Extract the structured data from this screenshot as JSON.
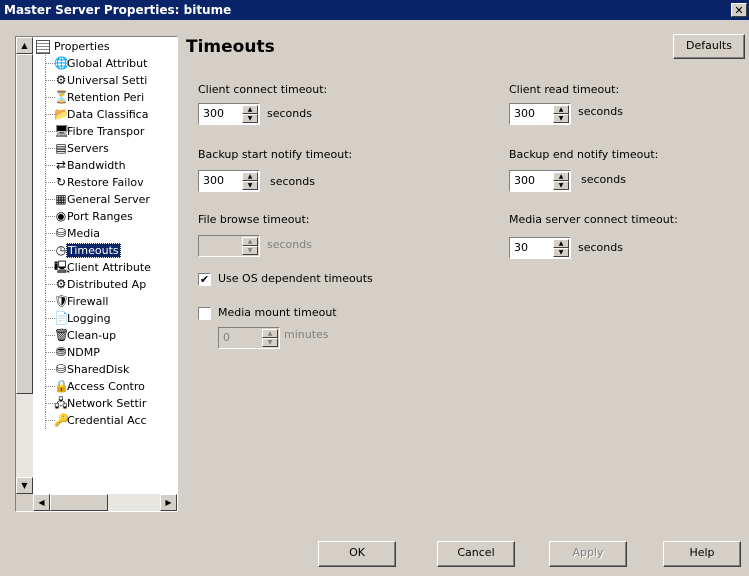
{
  "window": {
    "title": "Master Server Properties: bitume",
    "close_glyph": "✕"
  },
  "tree": {
    "root_label": "Properties",
    "items": [
      {
        "label": "Global Attribut",
        "icon": "globe-icon",
        "glyph": "🌐"
      },
      {
        "label": "Universal Setti",
        "icon": "settings-icon",
        "glyph": "⚙"
      },
      {
        "label": "Retention Peri",
        "icon": "retention-icon",
        "glyph": "⏳"
      },
      {
        "label": "Data Classifica",
        "icon": "data-classification-icon",
        "glyph": "📂"
      },
      {
        "label": "Fibre Transpor",
        "icon": "fibre-transport-icon",
        "glyph": "🖥"
      },
      {
        "label": "Servers",
        "icon": "servers-icon",
        "glyph": "▤"
      },
      {
        "label": "Bandwidth",
        "icon": "bandwidth-icon",
        "glyph": "⇄"
      },
      {
        "label": "Restore Failov",
        "icon": "restore-failover-icon",
        "glyph": "↻"
      },
      {
        "label": "General Server",
        "icon": "general-server-icon",
        "glyph": "▦"
      },
      {
        "label": "Port Ranges",
        "icon": "port-ranges-icon",
        "glyph": "◉"
      },
      {
        "label": "Media",
        "icon": "media-icon",
        "glyph": "⛁"
      },
      {
        "label": "Timeouts",
        "icon": "clock-icon",
        "glyph": "◷"
      },
      {
        "label": "Client Attribute",
        "icon": "client-attributes-icon",
        "glyph": "🖳"
      },
      {
        "label": "Distributed Ap",
        "icon": "distributed-app-icon",
        "glyph": "⚙"
      },
      {
        "label": "Firewall",
        "icon": "firewall-icon",
        "glyph": "🛡"
      },
      {
        "label": "Logging",
        "icon": "logging-icon",
        "glyph": "📄"
      },
      {
        "label": "Clean-up",
        "icon": "cleanup-icon",
        "glyph": "🗑"
      },
      {
        "label": "NDMP",
        "icon": "ndmp-icon",
        "glyph": "⛃"
      },
      {
        "label": "SharedDisk",
        "icon": "shared-disk-icon",
        "glyph": "⛁"
      },
      {
        "label": "Access Contro",
        "icon": "access-control-icon",
        "glyph": "🔒"
      },
      {
        "label": "Network Settir",
        "icon": "network-settings-icon",
        "glyph": "🖧"
      },
      {
        "label": "Credential Acc",
        "icon": "credential-access-icon",
        "glyph": "🔑"
      }
    ],
    "selected_index": 11
  },
  "panel": {
    "title": "Timeouts",
    "defaults_label": "Defaults",
    "client_connect": {
      "label": "Client connect timeout:",
      "value": "300",
      "unit": "seconds"
    },
    "client_read": {
      "label": "Client read timeout:",
      "value": "300",
      "unit": "seconds"
    },
    "backup_start": {
      "label": "Backup start notify timeout:",
      "value": "300",
      "unit": "seconds"
    },
    "backup_end": {
      "label": "Backup end notify timeout:",
      "value": "300",
      "unit": "seconds"
    },
    "file_browse": {
      "label": "File browse timeout:",
      "value": "",
      "unit": "seconds"
    },
    "media_server": {
      "label": "Media server connect timeout:",
      "value": "30",
      "unit": "seconds"
    },
    "use_os": {
      "label": "Use OS dependent timeouts",
      "checked": true
    },
    "media_mount": {
      "label": "Media mount timeout",
      "checked": false,
      "value": "0",
      "unit": "minutes"
    }
  },
  "buttons": {
    "ok": "OK",
    "cancel": "Cancel",
    "apply": "Apply",
    "help": "Help"
  }
}
